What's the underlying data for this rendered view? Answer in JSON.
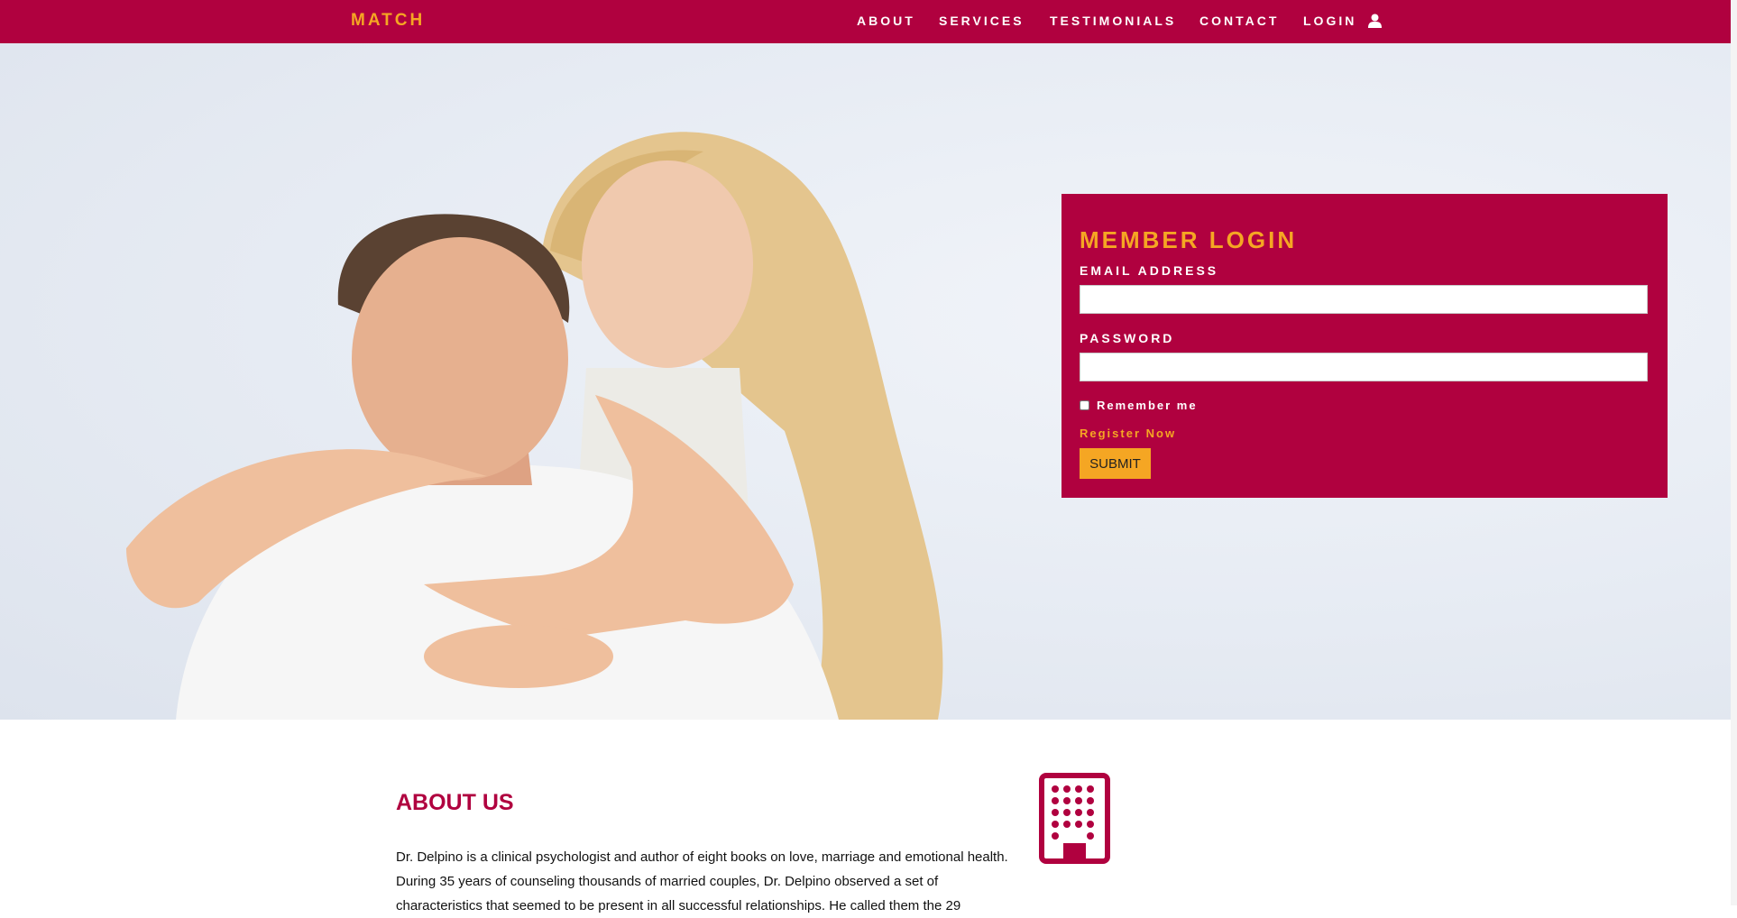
{
  "navbar": {
    "brand": "MATCH",
    "links": [
      {
        "label": "ABOUT"
      },
      {
        "label": "SERVICES"
      },
      {
        "label": "TESTIMONIALS"
      },
      {
        "label": "CONTACT"
      },
      {
        "label": "LOGIN",
        "icon": "user-icon"
      }
    ]
  },
  "login": {
    "title": "MEMBER LOGIN",
    "email_label": "EMAIL ADDRESS",
    "email_value": "",
    "password_label": "PASSWORD",
    "password_value": "",
    "remember_label": "Remember me",
    "remember_checked": false,
    "register_link": "Register Now",
    "submit_label": "SUBMIT"
  },
  "about": {
    "title": "ABOUT US",
    "text": "Dr. Delpino is a clinical psychologist and author of eight books on love, marriage and emotional health. During 35 years of counseling thousands of married couples, Dr. Delpino observed a set of characteristics that seemed to be present in all successful relationships. He called them the 29",
    "icon": "building-icon"
  },
  "colors": {
    "primary": "#b0013f",
    "accent": "#f5a623",
    "text": "#111111"
  }
}
